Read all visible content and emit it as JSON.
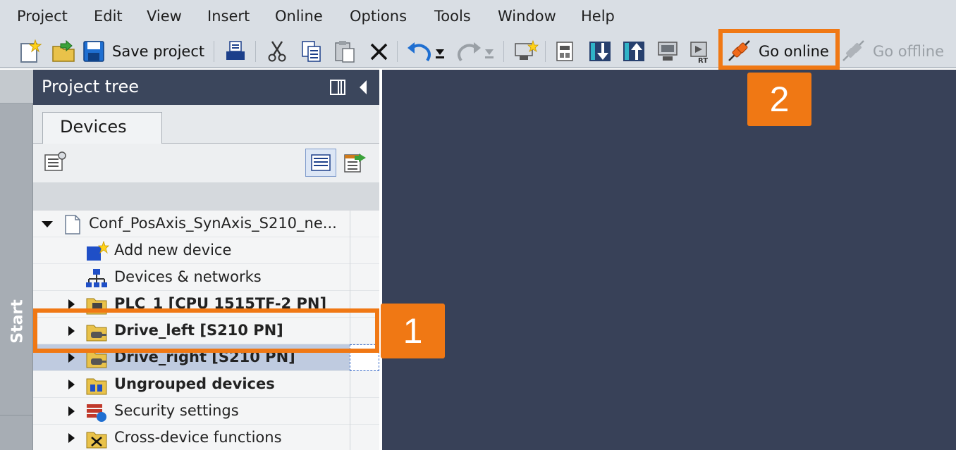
{
  "menu": {
    "items": [
      "Project",
      "Edit",
      "View",
      "Insert",
      "Online",
      "Options",
      "Tools",
      "Window",
      "Help"
    ]
  },
  "toolbar": {
    "save_label": "Save project",
    "go_online_label": "Go online",
    "go_offline_label": "Go offline"
  },
  "sidebar": {
    "start_label": "Start"
  },
  "project_tree": {
    "title": "Project tree",
    "tab_label": "Devices",
    "items": [
      {
        "label": "Conf_PosAxis_SynAxis_S210_ne...",
        "icon": "project-file-icon",
        "expanded": true
      },
      {
        "label": "Add new device",
        "icon": "add-device-icon"
      },
      {
        "label": "Devices & networks",
        "icon": "network-icon"
      },
      {
        "label": "PLC_1 [CPU 1515TF-2 PN]",
        "icon": "plc-icon"
      },
      {
        "label": "Drive_left [S210 PN]",
        "icon": "drive-icon"
      },
      {
        "label": "Drive_right [S210 PN]",
        "icon": "drive-icon",
        "selected": true
      },
      {
        "label": "Ungrouped devices",
        "icon": "ungrouped-devices-icon"
      },
      {
        "label": "Security settings",
        "icon": "security-icon"
      },
      {
        "label": "Cross-device functions",
        "icon": "cross-device-icon"
      }
    ]
  },
  "callouts": {
    "one": "1",
    "two": "2"
  },
  "colors": {
    "callout": "#f07814",
    "tree_header": "#3b465c",
    "workspace": "#384158",
    "selection": "#bfcbe0"
  }
}
